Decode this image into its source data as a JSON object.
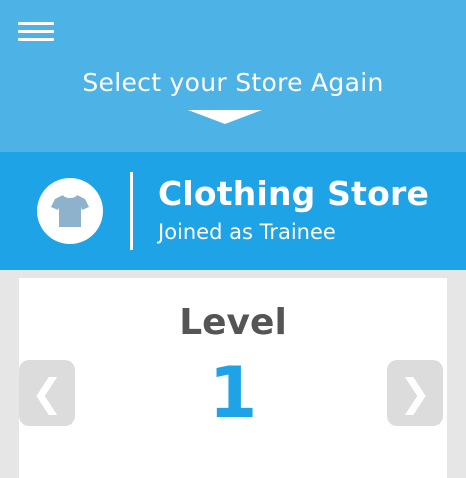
{
  "header": {
    "menu_icon": "hamburger-menu-icon",
    "select_store_label": "Select your Store Again",
    "chevron_icon": "chevron-down-icon"
  },
  "store": {
    "icon": "tshirt-icon",
    "name": "Clothing Store",
    "role": "Joined as Trainee"
  },
  "level": {
    "label": "Level",
    "value": "1",
    "prev_icon": "chevron-left-icon",
    "prev_glyph": "❮",
    "next_icon": "chevron-right-icon",
    "next_glyph": "❯"
  },
  "colors": {
    "top_bar": "#4db3e6",
    "store_band": "#1da3e6",
    "accent": "#1da3e6",
    "background": "#e6e6e6"
  }
}
